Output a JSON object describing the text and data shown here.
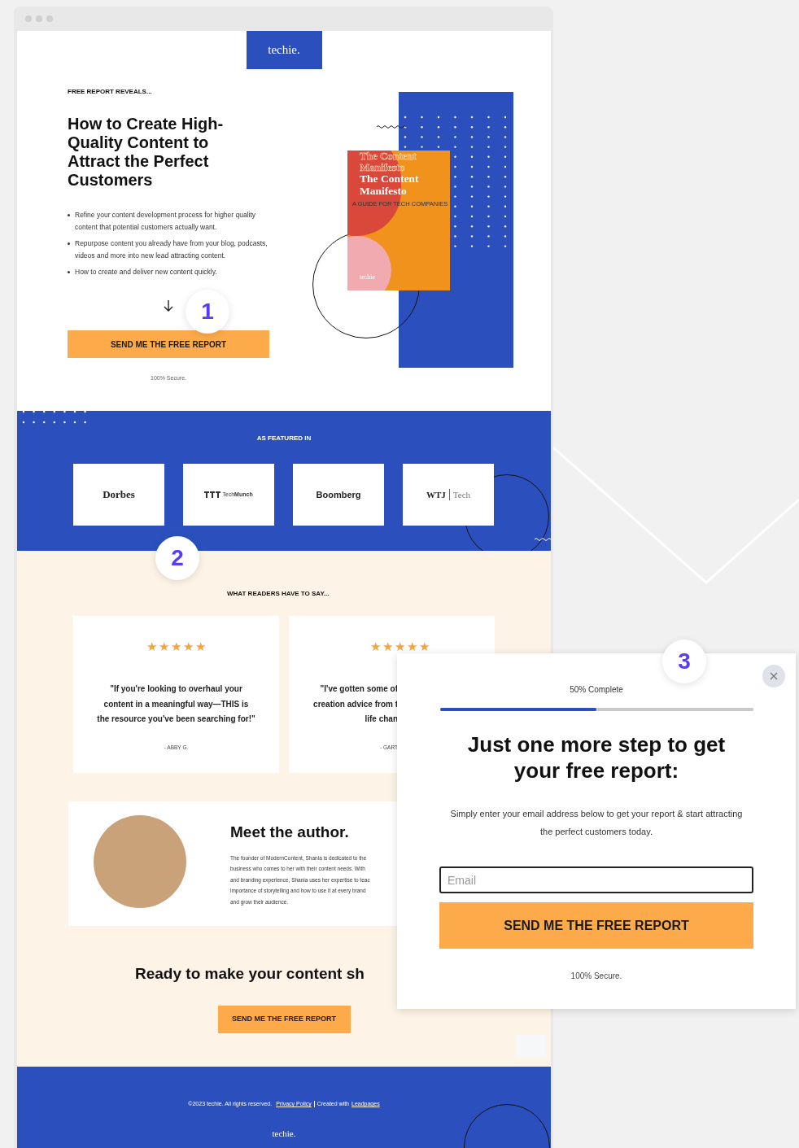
{
  "logo": "techie.",
  "hero": {
    "eyebrow": "FREE REPORT REVEALS...",
    "title": "How to Create High-Quality Content to Attract the Perfect Customers",
    "bullets": [
      "Refine your content development process for higher quality content that potential customers actually want.",
      "Repurpose content you already have from your blog, podcasts, videos and more into new lead attracting content.",
      "How to create and deliver new content quickly."
    ],
    "button": "SEND ME THE FREE REPORT",
    "secure_note": "100% Secure."
  },
  "book": {
    "ghost_title": "The Content Manifesto",
    "title": "The Content Manifesto",
    "subtitle": "A GUIDE FOR TECH COMPANIES",
    "brand": "techie"
  },
  "featured": {
    "heading": "AS FEATURED IN",
    "logos": [
      {
        "kind": "serif",
        "name": "Dorbes"
      },
      {
        "kind": "icon",
        "name": "Tech**Munch**"
      },
      {
        "kind": "sans",
        "name": "Boomberg"
      },
      {
        "kind": "split",
        "name": "WTJ",
        "suffix": "Tech"
      }
    ]
  },
  "testimonials": {
    "heading": "WHAT READERS HAVE TO SAY...",
    "items": [
      {
        "stars": 5,
        "quote": "\"If you're looking to overhaul your\ncontent in a meaningful way—THIS is\nthe resource you've been searching for!\"",
        "author": "- ABBY G.",
        "kind": "full"
      },
      {
        "stars": 5,
        "quote": "\"I've gotten some of\ncreation advice from t\nlife chan",
        "author": "- GART",
        "kind": "covered"
      }
    ]
  },
  "author": {
    "heading": "Meet the author.",
    "bio": "The founder of ModernContent, Shania is dedicated to the\nbusiness who comes to her with their content needs. With\nand branding experience, Shania uses her expertise to teac\nimportance of storytelling and how to use it at every brand\nand grow their audience."
  },
  "cta": {
    "heading": "Ready to make your content sh",
    "button": "SEND ME THE FREE REPORT"
  },
  "footer": {
    "copyright": "©2023 techie. All rights reserved.",
    "privacy_link": "Privacy Policy",
    "credit": "Created with",
    "credit_link": "Leadpages",
    "logo": "techie."
  },
  "popup": {
    "progress_label": "50% Complete",
    "level": 0.5,
    "heading": "Just one more step to get your free report:",
    "text": "Simply enter your email address below to get your report & start attracting the perfect customers today.",
    "email_placeholder": "Email",
    "button": "SEND ME THE FREE REPORT",
    "secure_note": "100% Secure."
  },
  "callouts": [
    {
      "label": "1"
    },
    {
      "label": "2"
    },
    {
      "label": "3"
    }
  ]
}
